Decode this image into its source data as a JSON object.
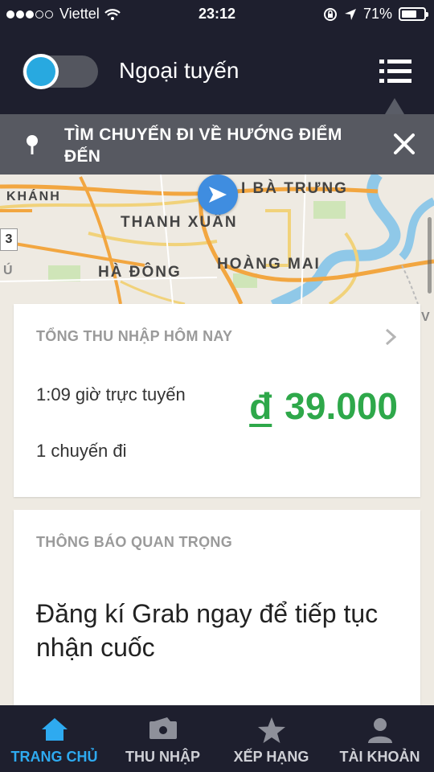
{
  "status_bar": {
    "carrier": "Viettel",
    "time": "23:12",
    "battery_percent": "71%",
    "battery_level": 0.71,
    "signal_bars_filled": 3,
    "signal_bars_total": 5
  },
  "header": {
    "status_text": "Ngoại tuyến",
    "toggle_on": false,
    "toggle_color": "#28a9e0"
  },
  "banner": {
    "text": "TÌM CHUYẾN ĐI VỀ HƯỚNG ĐIỂM ĐẾN",
    "pin_icon": "location-pin-icon",
    "close_icon": "close-icon"
  },
  "map": {
    "labels": {
      "khanh": "KHÁNH",
      "ba_trung": "I BÀ TRƯNG",
      "thanh_xuan": "THANH XUÂN",
      "ha_dong": "HÀ ĐÔNG",
      "hoang_mai": "HOÀNG MAI",
      "edge_u": "Ú",
      "edge_v": "V",
      "side_marker": "3"
    }
  },
  "earnings_card": {
    "title": "TỔNG THU NHẬP HÔM NAY",
    "online_hours": "1:09 giờ trực tuyến",
    "trip_count": "1 chuyến đi",
    "currency": "đ",
    "amount": "39.000",
    "amount_color": "#2ea84a"
  },
  "notice_card": {
    "title": "THÔNG BÁO QUAN TRỌNG",
    "body": "Đăng kí Grab ngay để tiếp tục nhận cuốc"
  },
  "bottom_nav": {
    "items": [
      {
        "label": "TRANG CHỦ",
        "icon": "home-icon",
        "active": true
      },
      {
        "label": "THU NHẬP",
        "icon": "wallet-icon",
        "active": false
      },
      {
        "label": "XẾP HẠNG",
        "icon": "star-icon",
        "active": false
      },
      {
        "label": "TÀI KHOẢN",
        "icon": "person-icon",
        "active": false
      }
    ],
    "active_color": "#2eaaf0"
  }
}
